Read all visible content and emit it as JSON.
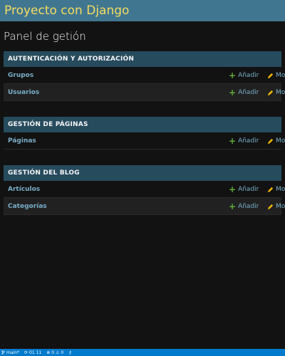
{
  "header": {
    "brand": "Proyecto con Django"
  },
  "page": {
    "title": "Panel de getión"
  },
  "modules": [
    {
      "caption": "Autenticación y autorización",
      "rows": [
        {
          "name": "Grupos",
          "add": "Añadir",
          "change": "Mod"
        },
        {
          "name": "Usuarios",
          "add": "Añadir",
          "change": "Mod"
        }
      ]
    },
    {
      "caption": "Gestión de páginas",
      "rows": [
        {
          "name": "Páginas",
          "add": "Añadir",
          "change": "Mod"
        }
      ]
    },
    {
      "caption": "Gestión del blog",
      "rows": [
        {
          "name": "Artículos",
          "add": "Añadir",
          "change": "Mod"
        },
        {
          "name": "Categorías",
          "add": "Añadir",
          "change": "Mod"
        }
      ]
    }
  ],
  "statusbar": {
    "branch": "main*",
    "sync": "01 11",
    "errors": "0",
    "warnings": "0"
  },
  "colors": {
    "header_bg": "#417690",
    "brand": "#f5dd5d",
    "caption_bg": "#264b5d",
    "link": "#79aec8",
    "add_icon": "#5fad3a",
    "edit_icon": "#efb80b",
    "statusbar_bg": "#007acc"
  },
  "icons": {
    "add": "plus-icon",
    "change": "pencil-icon",
    "branch": "git-branch-icon",
    "sync": "sync-icon",
    "errors": "error-icon",
    "warnings": "warning-icon",
    "extra": "key-icon"
  }
}
